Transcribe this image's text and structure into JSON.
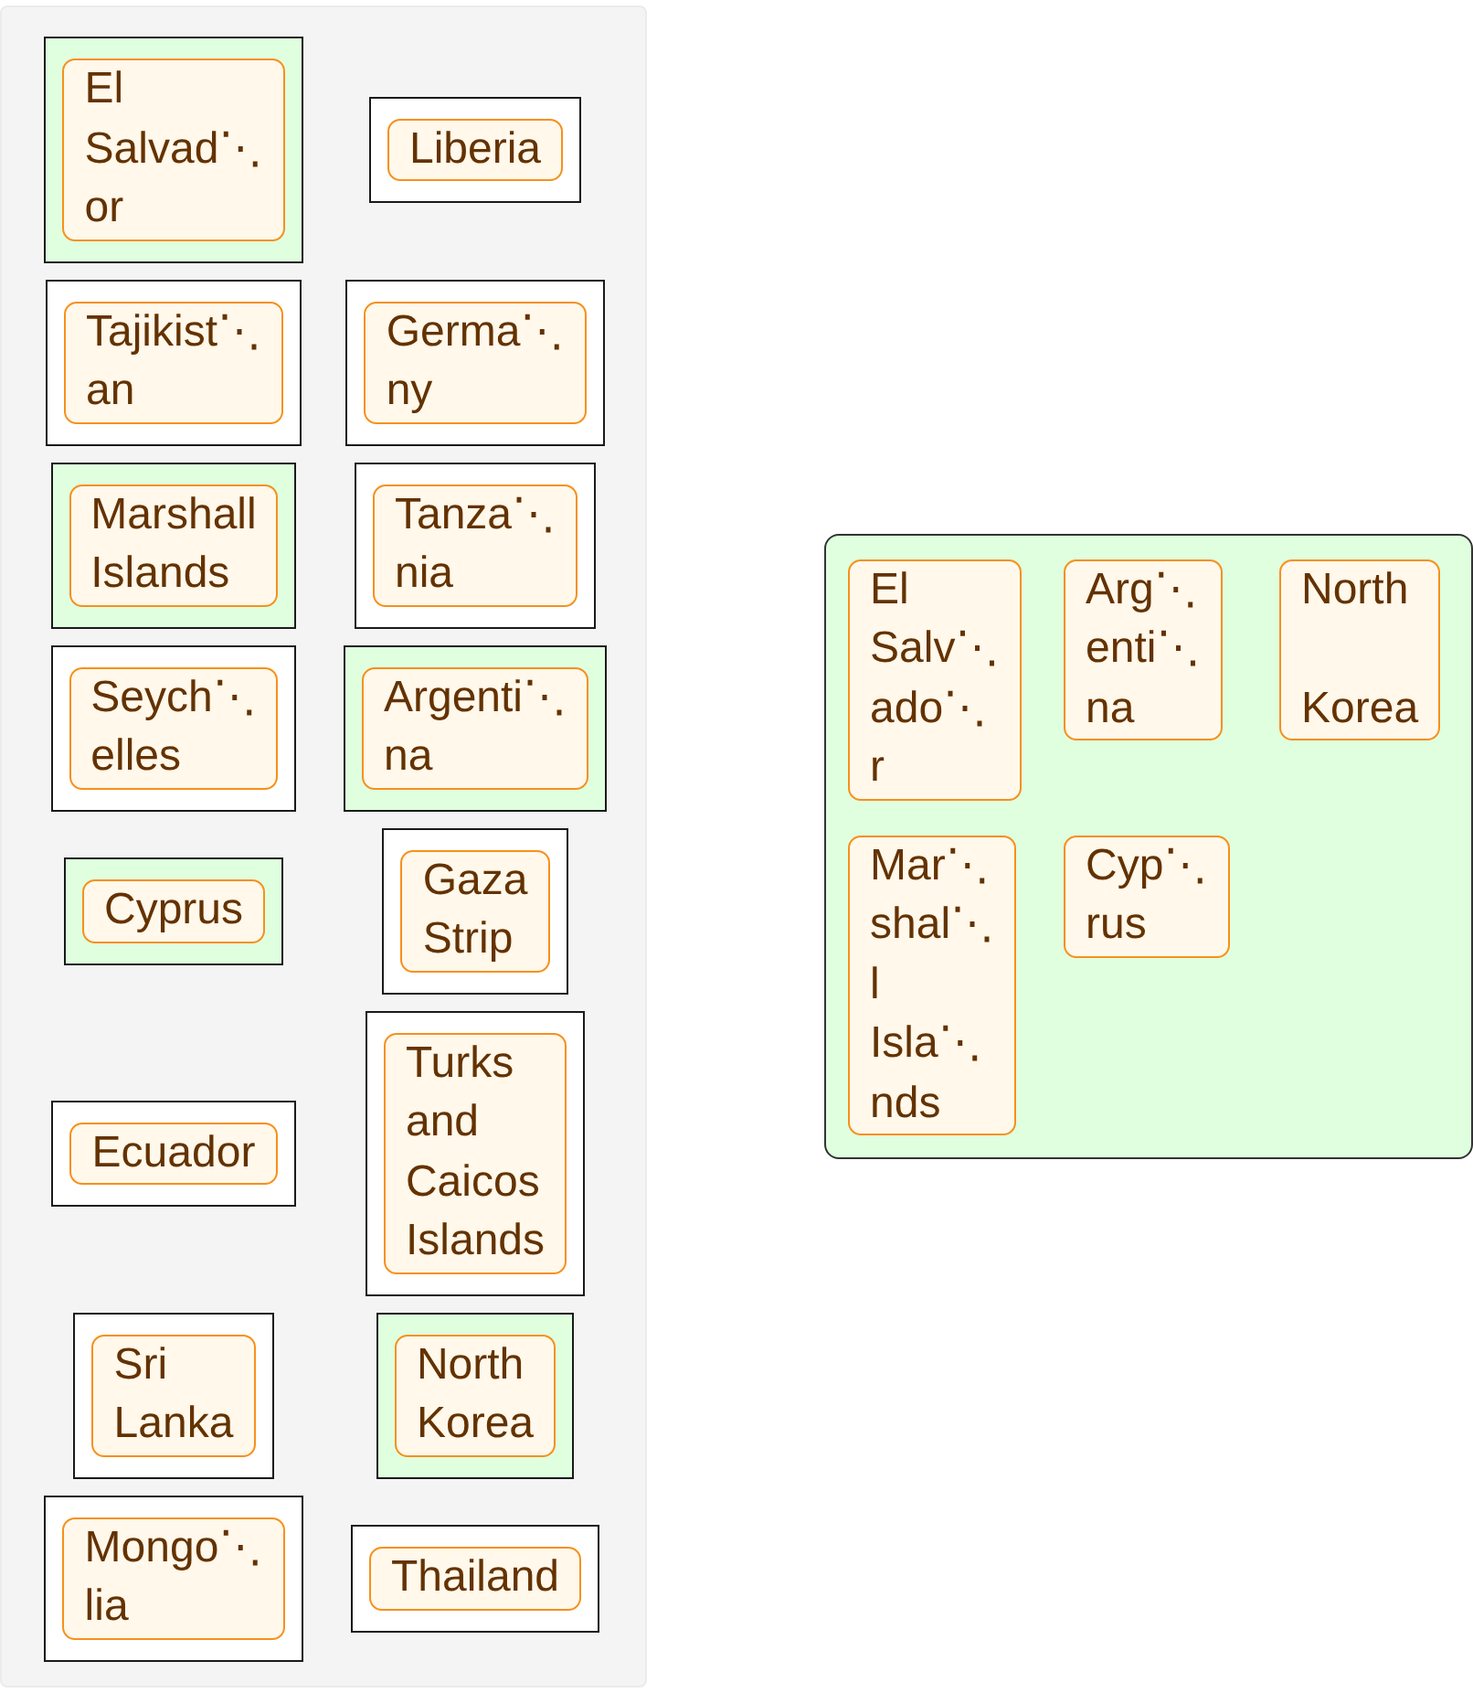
{
  "available": {
    "items": [
      {
        "label": "El\nSalvad⋱\nor",
        "selected": true
      },
      {
        "label": "Tajikist⋱\nan",
        "selected": false
      },
      {
        "label": "Marshall\nIslands",
        "selected": true
      },
      {
        "label": "Seych⋱\nelles",
        "selected": false
      },
      {
        "label": "Cyprus",
        "selected": true
      },
      {
        "label": "Ecuador",
        "selected": false
      },
      {
        "label": "Sri\nLanka",
        "selected": false
      },
      {
        "label": "Mongo⋱\nlia",
        "selected": false
      },
      {
        "label": "Liberia",
        "selected": false
      },
      {
        "label": "Germa⋱\nny",
        "selected": false
      },
      {
        "label": "Tanza⋱\nnia",
        "selected": false
      },
      {
        "label": "Argenti⋱\nna",
        "selected": true
      },
      {
        "label": "Gaza\nStrip",
        "selected": false
      },
      {
        "label": "Turks\nand\nCaicos\nIslands",
        "selected": false
      },
      {
        "label": "North\nKorea",
        "selected": true
      },
      {
        "label": "Thailand",
        "selected": false
      }
    ]
  },
  "chosen": {
    "items": [
      {
        "label": "El\nSalv⋱\nado⋱\nr"
      },
      {
        "label": "Arg⋱\nenti⋱\nna"
      },
      {
        "label": "North\n\nKorea"
      },
      {
        "label": "Mar⋱\nshal⋱\nl\nIsla⋱\nnds"
      },
      {
        "label": "Cyp⋱\nrus"
      }
    ]
  }
}
